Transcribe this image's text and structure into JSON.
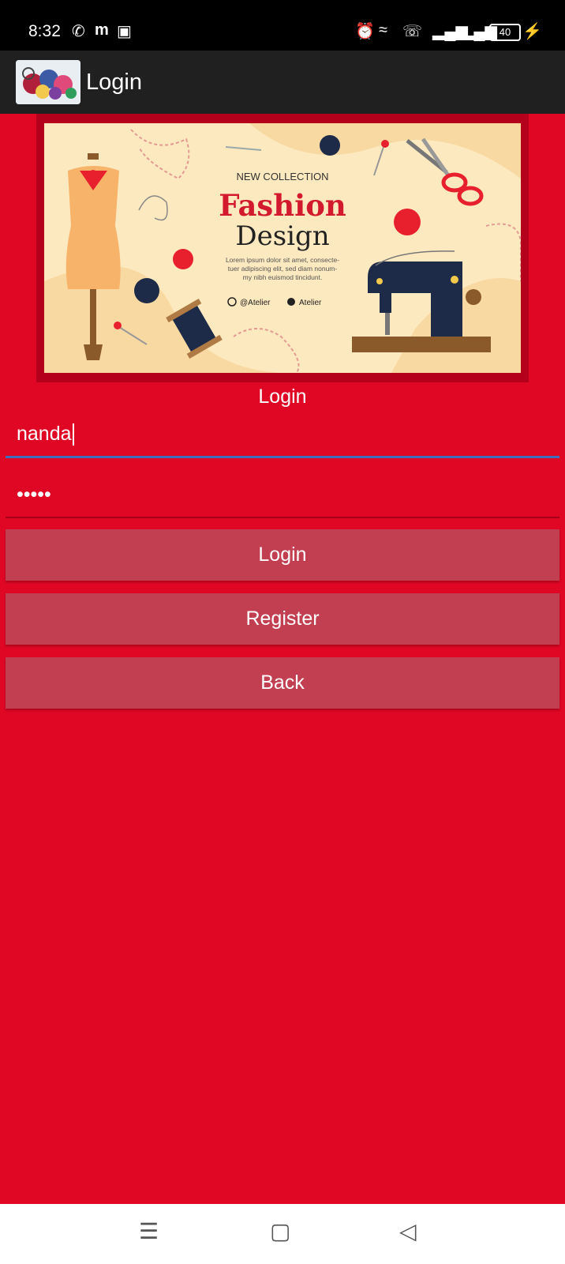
{
  "status_bar": {
    "time": "8:32",
    "icons": [
      "whatsapp-icon",
      "m-app-icon",
      "scan-icon",
      "alarm-icon",
      "wifi-icon",
      "volte-call-icon",
      "signal-icon",
      "signal-icon",
      "battery-icon",
      "charging-icon"
    ],
    "battery_level": "40"
  },
  "app_bar": {
    "title": "Login",
    "logo": "app-logo-image"
  },
  "banner": {
    "eyebrow": "NEW COLLECTION",
    "headline_1": "Fashion",
    "headline_2": "Design",
    "body_line_1": "Lorem ipsum dolor sit amet, consecte-",
    "body_line_2": "tuer adipiscing elit, sed diam nonum-",
    "body_line_3": "my nibh euismod tincidunt.",
    "social_1": "@Atelier",
    "social_2": "Atelier",
    "colors": {
      "bg": "#fde9bf",
      "accent": "#d3192d",
      "dark": "#1d2b48"
    }
  },
  "form": {
    "section_title": "Login",
    "username_value": "nanda",
    "password_value": "•••••"
  },
  "buttons": {
    "login": "Login",
    "register": "Register",
    "back": "Back"
  },
  "nav_bar": {
    "icons": [
      "menu-icon",
      "home-icon",
      "back-icon"
    ]
  },
  "colors": {
    "background": "#e00725",
    "button": "#c23f52",
    "app_bar": "#202020",
    "field_focus": "#3f6ebd"
  }
}
